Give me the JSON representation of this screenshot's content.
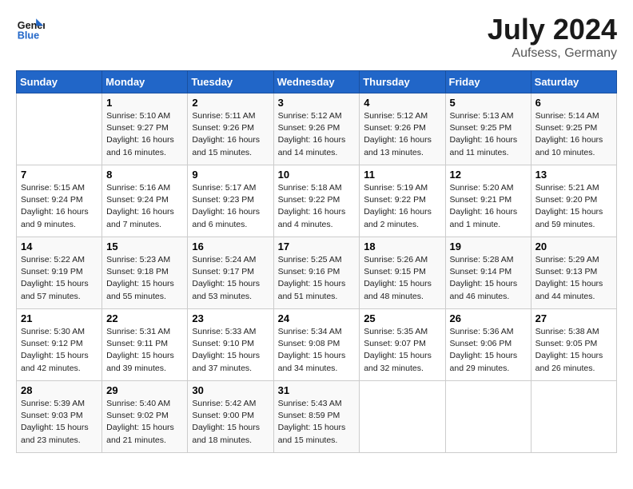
{
  "header": {
    "logo_text_general": "General",
    "logo_text_blue": "Blue",
    "month_year": "July 2024",
    "location": "Aufsess, Germany"
  },
  "weekdays": [
    "Sunday",
    "Monday",
    "Tuesday",
    "Wednesday",
    "Thursday",
    "Friday",
    "Saturday"
  ],
  "weeks": [
    [
      {
        "day": "",
        "sunrise": "",
        "sunset": "",
        "daylight": ""
      },
      {
        "day": "1",
        "sunrise": "Sunrise: 5:10 AM",
        "sunset": "Sunset: 9:27 PM",
        "daylight": "Daylight: 16 hours and 16 minutes."
      },
      {
        "day": "2",
        "sunrise": "Sunrise: 5:11 AM",
        "sunset": "Sunset: 9:26 PM",
        "daylight": "Daylight: 16 hours and 15 minutes."
      },
      {
        "day": "3",
        "sunrise": "Sunrise: 5:12 AM",
        "sunset": "Sunset: 9:26 PM",
        "daylight": "Daylight: 16 hours and 14 minutes."
      },
      {
        "day": "4",
        "sunrise": "Sunrise: 5:12 AM",
        "sunset": "Sunset: 9:26 PM",
        "daylight": "Daylight: 16 hours and 13 minutes."
      },
      {
        "day": "5",
        "sunrise": "Sunrise: 5:13 AM",
        "sunset": "Sunset: 9:25 PM",
        "daylight": "Daylight: 16 hours and 11 minutes."
      },
      {
        "day": "6",
        "sunrise": "Sunrise: 5:14 AM",
        "sunset": "Sunset: 9:25 PM",
        "daylight": "Daylight: 16 hours and 10 minutes."
      }
    ],
    [
      {
        "day": "7",
        "sunrise": "Sunrise: 5:15 AM",
        "sunset": "Sunset: 9:24 PM",
        "daylight": "Daylight: 16 hours and 9 minutes."
      },
      {
        "day": "8",
        "sunrise": "Sunrise: 5:16 AM",
        "sunset": "Sunset: 9:24 PM",
        "daylight": "Daylight: 16 hours and 7 minutes."
      },
      {
        "day": "9",
        "sunrise": "Sunrise: 5:17 AM",
        "sunset": "Sunset: 9:23 PM",
        "daylight": "Daylight: 16 hours and 6 minutes."
      },
      {
        "day": "10",
        "sunrise": "Sunrise: 5:18 AM",
        "sunset": "Sunset: 9:22 PM",
        "daylight": "Daylight: 16 hours and 4 minutes."
      },
      {
        "day": "11",
        "sunrise": "Sunrise: 5:19 AM",
        "sunset": "Sunset: 9:22 PM",
        "daylight": "Daylight: 16 hours and 2 minutes."
      },
      {
        "day": "12",
        "sunrise": "Sunrise: 5:20 AM",
        "sunset": "Sunset: 9:21 PM",
        "daylight": "Daylight: 16 hours and 1 minute."
      },
      {
        "day": "13",
        "sunrise": "Sunrise: 5:21 AM",
        "sunset": "Sunset: 9:20 PM",
        "daylight": "Daylight: 15 hours and 59 minutes."
      }
    ],
    [
      {
        "day": "14",
        "sunrise": "Sunrise: 5:22 AM",
        "sunset": "Sunset: 9:19 PM",
        "daylight": "Daylight: 15 hours and 57 minutes."
      },
      {
        "day": "15",
        "sunrise": "Sunrise: 5:23 AM",
        "sunset": "Sunset: 9:18 PM",
        "daylight": "Daylight: 15 hours and 55 minutes."
      },
      {
        "day": "16",
        "sunrise": "Sunrise: 5:24 AM",
        "sunset": "Sunset: 9:17 PM",
        "daylight": "Daylight: 15 hours and 53 minutes."
      },
      {
        "day": "17",
        "sunrise": "Sunrise: 5:25 AM",
        "sunset": "Sunset: 9:16 PM",
        "daylight": "Daylight: 15 hours and 51 minutes."
      },
      {
        "day": "18",
        "sunrise": "Sunrise: 5:26 AM",
        "sunset": "Sunset: 9:15 PM",
        "daylight": "Daylight: 15 hours and 48 minutes."
      },
      {
        "day": "19",
        "sunrise": "Sunrise: 5:28 AM",
        "sunset": "Sunset: 9:14 PM",
        "daylight": "Daylight: 15 hours and 46 minutes."
      },
      {
        "day": "20",
        "sunrise": "Sunrise: 5:29 AM",
        "sunset": "Sunset: 9:13 PM",
        "daylight": "Daylight: 15 hours and 44 minutes."
      }
    ],
    [
      {
        "day": "21",
        "sunrise": "Sunrise: 5:30 AM",
        "sunset": "Sunset: 9:12 PM",
        "daylight": "Daylight: 15 hours and 42 minutes."
      },
      {
        "day": "22",
        "sunrise": "Sunrise: 5:31 AM",
        "sunset": "Sunset: 9:11 PM",
        "daylight": "Daylight: 15 hours and 39 minutes."
      },
      {
        "day": "23",
        "sunrise": "Sunrise: 5:33 AM",
        "sunset": "Sunset: 9:10 PM",
        "daylight": "Daylight: 15 hours and 37 minutes."
      },
      {
        "day": "24",
        "sunrise": "Sunrise: 5:34 AM",
        "sunset": "Sunset: 9:08 PM",
        "daylight": "Daylight: 15 hours and 34 minutes."
      },
      {
        "day": "25",
        "sunrise": "Sunrise: 5:35 AM",
        "sunset": "Sunset: 9:07 PM",
        "daylight": "Daylight: 15 hours and 32 minutes."
      },
      {
        "day": "26",
        "sunrise": "Sunrise: 5:36 AM",
        "sunset": "Sunset: 9:06 PM",
        "daylight": "Daylight: 15 hours and 29 minutes."
      },
      {
        "day": "27",
        "sunrise": "Sunrise: 5:38 AM",
        "sunset": "Sunset: 9:05 PM",
        "daylight": "Daylight: 15 hours and 26 minutes."
      }
    ],
    [
      {
        "day": "28",
        "sunrise": "Sunrise: 5:39 AM",
        "sunset": "Sunset: 9:03 PM",
        "daylight": "Daylight: 15 hours and 23 minutes."
      },
      {
        "day": "29",
        "sunrise": "Sunrise: 5:40 AM",
        "sunset": "Sunset: 9:02 PM",
        "daylight": "Daylight: 15 hours and 21 minutes."
      },
      {
        "day": "30",
        "sunrise": "Sunrise: 5:42 AM",
        "sunset": "Sunset: 9:00 PM",
        "daylight": "Daylight: 15 hours and 18 minutes."
      },
      {
        "day": "31",
        "sunrise": "Sunrise: 5:43 AM",
        "sunset": "Sunset: 8:59 PM",
        "daylight": "Daylight: 15 hours and 15 minutes."
      },
      {
        "day": "",
        "sunrise": "",
        "sunset": "",
        "daylight": ""
      },
      {
        "day": "",
        "sunrise": "",
        "sunset": "",
        "daylight": ""
      },
      {
        "day": "",
        "sunrise": "",
        "sunset": "",
        "daylight": ""
      }
    ]
  ]
}
